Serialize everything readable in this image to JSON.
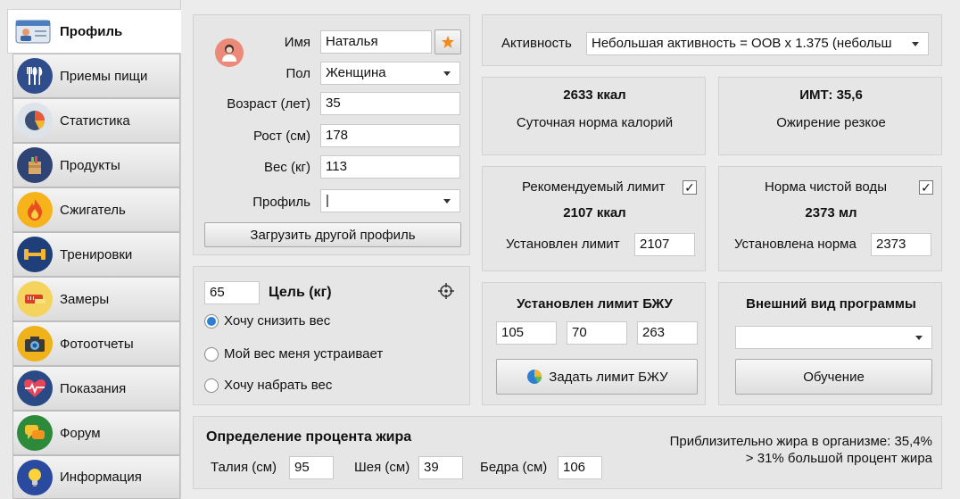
{
  "colors": {
    "accent": "#2d7fd3",
    "avatar_bg": "#ec8a7a",
    "star": "#f08c1e"
  },
  "sidebar": {
    "items": [
      {
        "label": "Профиль",
        "icon": "id-card-icon",
        "color": "#ffffff",
        "active": true
      },
      {
        "label": "Приемы пищи",
        "icon": "cutlery-icon",
        "color": "#2f4d8c"
      },
      {
        "label": "Статистика",
        "icon": "pie-chart-icon",
        "color": "#5a6b86"
      },
      {
        "label": "Продукты",
        "icon": "grocery-bag-icon",
        "color": "#2e4474"
      },
      {
        "label": "Сжигатель",
        "icon": "flame-icon",
        "color": "#f6b31c"
      },
      {
        "label": "Тренировки",
        "icon": "dumbbell-icon",
        "color": "#1f3f7a"
      },
      {
        "label": "Замеры",
        "icon": "tape-measure-icon",
        "color": "#f4d35e"
      },
      {
        "label": "Фотоотчеты",
        "icon": "camera-icon",
        "color": "#f0b21a"
      },
      {
        "label": "Показания",
        "icon": "heartbeat-icon",
        "color": "#2a4a86"
      },
      {
        "label": "Форум",
        "icon": "chat-bubbles-icon",
        "color": "#2d8a3a"
      },
      {
        "label": "Информация",
        "icon": "lightbulb-icon",
        "color": "#2a4aa0"
      }
    ]
  },
  "profile": {
    "name_label": "Имя",
    "name_value": "Наталья",
    "gender_label": "Пол",
    "gender_value": "Женщина",
    "age_label": "Возраст (лет)",
    "age_value": "35",
    "height_label": "Рост (см)",
    "height_value": "178",
    "weight_label": "Вес (кг)",
    "weight_value": "113",
    "profile_label": "Профиль",
    "profile_value": "|",
    "load_button": "Загрузить другой профиль"
  },
  "goal": {
    "value": "65",
    "label": "Цель (кг)",
    "options": [
      "Хочу снизить вес",
      "Мой вес меня устраивает",
      "Хочу набрать вес"
    ],
    "selected": 0
  },
  "activity": {
    "label": "Активность",
    "value": "Небольшая активность = ООВ x 1.375 (небольш"
  },
  "calories": {
    "value": "2633 ккал",
    "caption": "Суточная норма калорий"
  },
  "bmi": {
    "value": "ИМТ: 35,6",
    "caption": "Ожирение резкое"
  },
  "limit": {
    "checkbox_label": "Рекомендуемый лимит",
    "checked": true,
    "value": "2107 ккал",
    "set_label": "Установлен лимит",
    "set_value": "2107"
  },
  "water": {
    "checkbox_label": "Норма чистой воды",
    "checked": true,
    "value": "2373 мл",
    "set_label": "Установлена норма",
    "set_value": "2373"
  },
  "bju": {
    "title": "Установлен лимит БЖУ",
    "protein": "105",
    "fat": "70",
    "carbs": "263",
    "button": "Задать лимит БЖУ"
  },
  "appearance": {
    "title": "Внешний вид программы",
    "value": "",
    "button": "Обучение"
  },
  "fat": {
    "title": "Определение процента жира",
    "waist_label": "Талия (см)",
    "waist_value": "95",
    "neck_label": "Шея (см)",
    "neck_value": "39",
    "hips_label": "Бедра (см)",
    "hips_value": "106",
    "result_line1": "Приблизительно жира в организме: 35,4%",
    "result_line2": "> 31% большой процент жира"
  }
}
